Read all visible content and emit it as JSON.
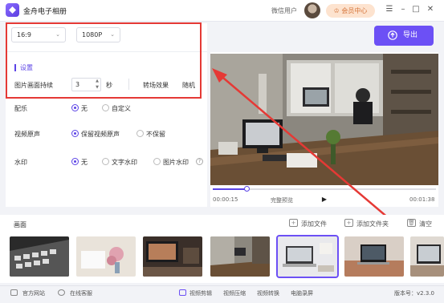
{
  "app": {
    "title": "金舟电子相册",
    "user_label": "微信用户",
    "vip_button": "会员中心"
  },
  "toolbar": {
    "aspect_ratio": "16:9",
    "resolution": "1080P",
    "export_label": "导出"
  },
  "settings": {
    "title": "设置",
    "duration_label": "图片画面持续",
    "duration_value": "3",
    "duration_unit": "秒",
    "transition_label": "转场效果",
    "transition_value": "随机",
    "music": {
      "label": "配乐",
      "options": [
        "无",
        "自定义"
      ],
      "selected": "无"
    },
    "original_audio": {
      "label": "视频原声",
      "options": [
        "保留视频原声",
        "不保留"
      ],
      "selected": "保留视频原声"
    },
    "watermark": {
      "label": "水印",
      "options": [
        "无",
        "文字水印",
        "图片水印"
      ],
      "selected": "无"
    }
  },
  "preview": {
    "current_time": "00:00:15",
    "total_time": "00:01:38",
    "label": "完整预览",
    "progress": 0.15
  },
  "frames": {
    "title": "画面",
    "add_file": "添加文件",
    "add_folder": "添加文件夹",
    "clear": "清空",
    "count_visible": 8
  },
  "status": {
    "website": "官方网站",
    "support": "在线客服",
    "tools": [
      "视频剪辑",
      "视频压缩",
      "视频转换",
      "电脑录屏"
    ],
    "version": "版本号：v2.3.0"
  },
  "colors": {
    "accent": "#6c50f5",
    "annotation": "#e53935",
    "vip": "#d5743a"
  }
}
